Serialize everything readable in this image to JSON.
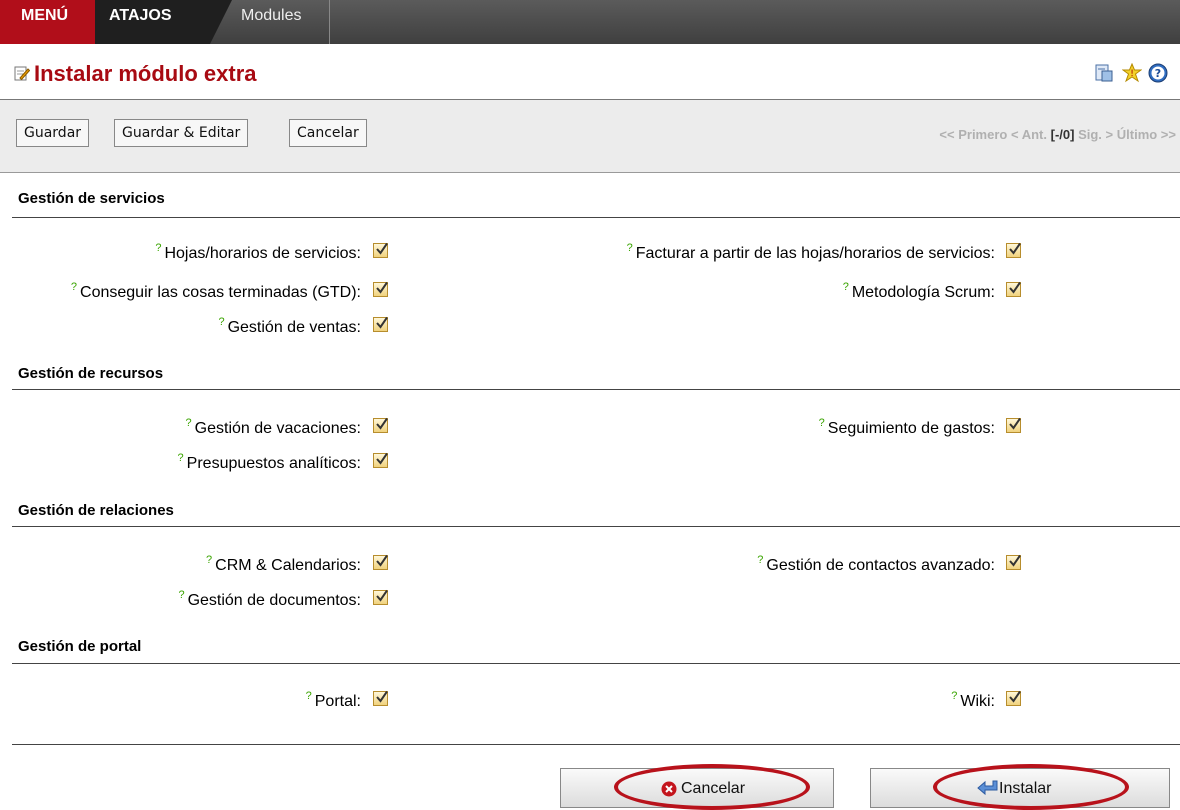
{
  "menubar": {
    "menu": "MENÚ",
    "atajos": "ATAJOS",
    "modules": "Modules"
  },
  "title": "Instalar módulo extra",
  "toolbar": {
    "save": "Guardar",
    "save_edit": "Guardar & Editar",
    "cancel": "Cancelar"
  },
  "pager": {
    "first": "<< Primero",
    "prev": "< Ant.",
    "position": "[-/0]",
    "next": "Sig. >",
    "last": "Último >>"
  },
  "sections": [
    {
      "title": "Gestión de servicios",
      "fields": [
        {
          "label": "Hojas/horarios de servicios:",
          "checked": true
        },
        {
          "label": "Facturar a partir de las hojas/horarios de servicios:",
          "checked": true
        },
        {
          "label": "Conseguir las cosas terminadas (GTD):",
          "checked": true
        },
        {
          "label": "Metodología Scrum:",
          "checked": true
        },
        {
          "label": "Gestión de ventas:",
          "checked": true
        }
      ]
    },
    {
      "title": "Gestión de recursos",
      "fields": [
        {
          "label": "Gestión de vacaciones:",
          "checked": true
        },
        {
          "label": "Seguimiento de gastos:",
          "checked": true
        },
        {
          "label": "Presupuestos analíticos:",
          "checked": true
        }
      ]
    },
    {
      "title": "Gestión de relaciones",
      "fields": [
        {
          "label": "CRM & Calendarios:",
          "checked": true
        },
        {
          "label": "Gestión de contactos avanzado:",
          "checked": true
        },
        {
          "label": "Gestión de documentos:",
          "checked": true
        }
      ]
    },
    {
      "title": "Gestión de portal",
      "fields": [
        {
          "label": "Portal:",
          "checked": true
        },
        {
          "label": "Wiki:",
          "checked": true
        }
      ]
    }
  ],
  "help_mark": "?",
  "footer": {
    "cancel": "Cancelar",
    "install": "Instalar"
  },
  "icons": [
    "edit-document-icon",
    "translate-icon",
    "debug-icon",
    "help-icon",
    "cancel-circle-icon",
    "install-arrow-icon",
    "check-icon"
  ],
  "colors": {
    "brand_red": "#b10e1a",
    "title_red": "#a80a12",
    "help_green": "#3aa400"
  }
}
